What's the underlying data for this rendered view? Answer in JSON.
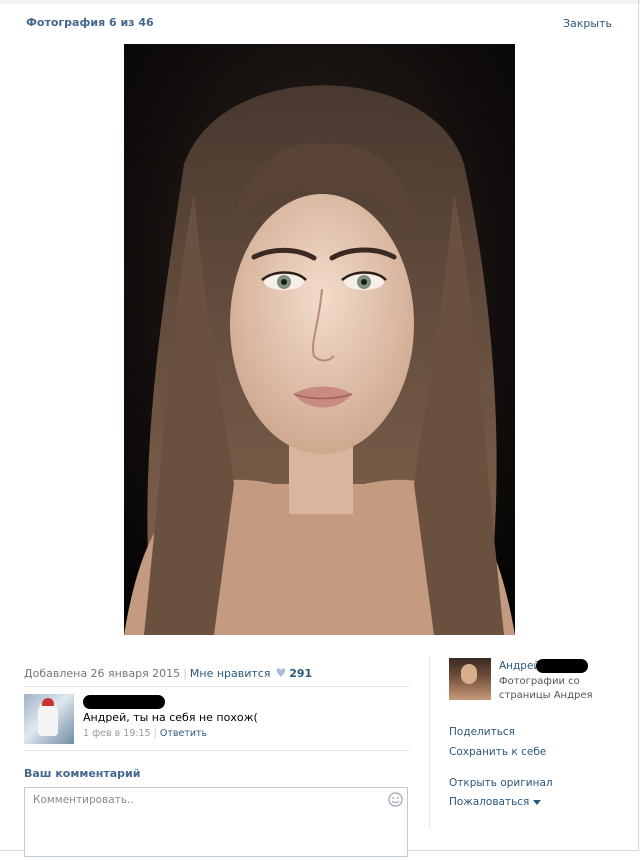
{
  "header": {
    "title": "Фотография 6 из 46",
    "close_label": "Закрыть"
  },
  "photo": {
    "subject": "portrait-photo"
  },
  "meta": {
    "added": "Добавлена 26 января 2015",
    "like_label": "Мне нравится",
    "like_count": "291"
  },
  "comment": {
    "text": "Андрей, ты на себя не похож(",
    "date": "1 фев в 19:15",
    "reply_label": "Ответить"
  },
  "compose": {
    "heading": "Ваш комментарий",
    "placeholder": "Комментировать.."
  },
  "owner": {
    "name": "Андрей",
    "subtitle_line1": "Фотографии со",
    "subtitle_line2": "страницы Андрея"
  },
  "actions": {
    "share": "Поделиться",
    "save": "Сохранить к себе",
    "original": "Открыть оригинал",
    "report": "Пожаловаться"
  },
  "colors": {
    "link": "#2b587a",
    "heading": "#45688e"
  }
}
